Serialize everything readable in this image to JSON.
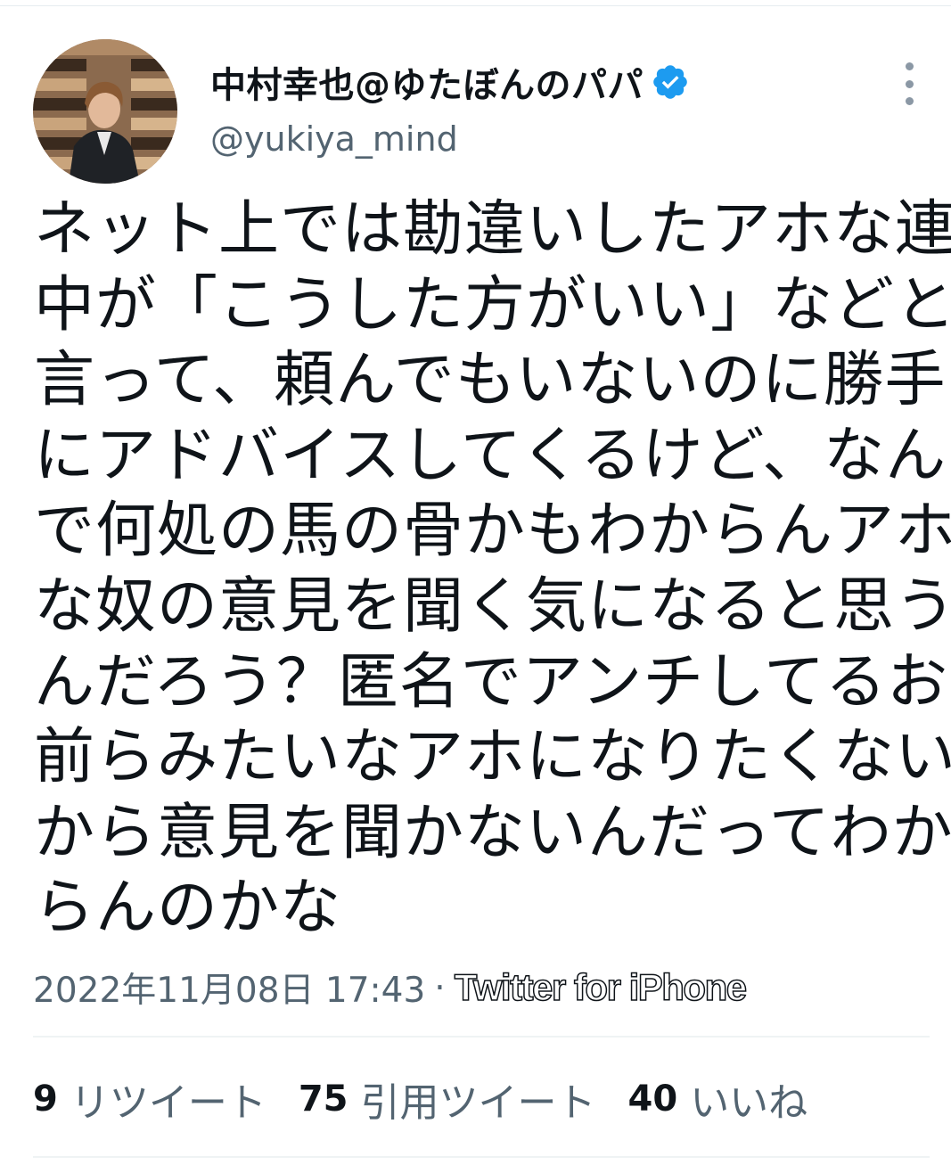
{
  "tweet": {
    "author": {
      "display_name": "中村幸也@ゆたぼんのパパ",
      "handle": "@yukiya_mind",
      "verified": true,
      "verified_color": "#1d9bf0"
    },
    "text_lines": [
      "ネット上では勘違いしたアホな連",
      "中が「こうした方がいい」などと",
      "言って、頼んでもいないのに勝手",
      "にアドバイスしてくるけど、なん",
      "で何処の馬の骨かもわからんアホ",
      "な奴の意見を聞く気になると思う",
      "んだろう？匿名でアンチしてるお",
      "前らみたいなアホになりたくない",
      "から意見を聞かないんだってわか",
      "らんのかな"
    ],
    "timestamp": "2022年11月08日 17:43",
    "separator": "·",
    "source": "Twitter for iPhone",
    "stats": {
      "retweets": {
        "count": "9",
        "label": "リツイート"
      },
      "quotes": {
        "count": "75",
        "label": "引用ツイート"
      },
      "likes": {
        "count": "40",
        "label": "いいね"
      }
    }
  },
  "icons": {
    "verified": "verified-badge-icon",
    "more": "more-vertical-icon"
  }
}
